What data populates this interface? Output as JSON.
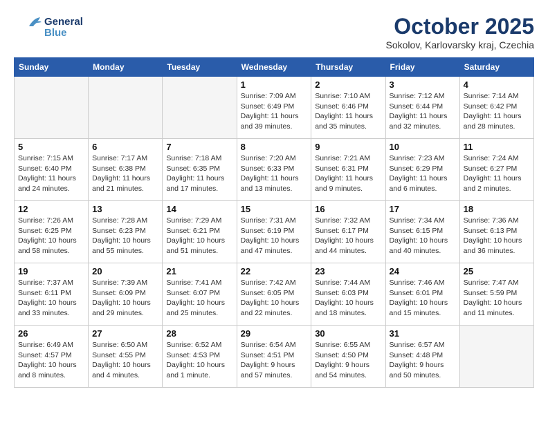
{
  "header": {
    "logo_general": "General",
    "logo_blue": "Blue",
    "month_title": "October 2025",
    "location": "Sokolov, Karlovarsky kraj, Czechia"
  },
  "weekdays": [
    "Sunday",
    "Monday",
    "Tuesday",
    "Wednesday",
    "Thursday",
    "Friday",
    "Saturday"
  ],
  "weeks": [
    [
      {
        "day": "",
        "empty": true
      },
      {
        "day": "",
        "empty": true
      },
      {
        "day": "",
        "empty": true
      },
      {
        "day": "1",
        "sunrise": "7:09 AM",
        "sunset": "6:49 PM",
        "daylight": "11 hours and 39 minutes."
      },
      {
        "day": "2",
        "sunrise": "7:10 AM",
        "sunset": "6:46 PM",
        "daylight": "11 hours and 35 minutes."
      },
      {
        "day": "3",
        "sunrise": "7:12 AM",
        "sunset": "6:44 PM",
        "daylight": "11 hours and 32 minutes."
      },
      {
        "day": "4",
        "sunrise": "7:14 AM",
        "sunset": "6:42 PM",
        "daylight": "11 hours and 28 minutes."
      }
    ],
    [
      {
        "day": "5",
        "sunrise": "7:15 AM",
        "sunset": "6:40 PM",
        "daylight": "11 hours and 24 minutes."
      },
      {
        "day": "6",
        "sunrise": "7:17 AM",
        "sunset": "6:38 PM",
        "daylight": "11 hours and 21 minutes."
      },
      {
        "day": "7",
        "sunrise": "7:18 AM",
        "sunset": "6:35 PM",
        "daylight": "11 hours and 17 minutes."
      },
      {
        "day": "8",
        "sunrise": "7:20 AM",
        "sunset": "6:33 PM",
        "daylight": "11 hours and 13 minutes."
      },
      {
        "day": "9",
        "sunrise": "7:21 AM",
        "sunset": "6:31 PM",
        "daylight": "11 hours and 9 minutes."
      },
      {
        "day": "10",
        "sunrise": "7:23 AM",
        "sunset": "6:29 PM",
        "daylight": "11 hours and 6 minutes."
      },
      {
        "day": "11",
        "sunrise": "7:24 AM",
        "sunset": "6:27 PM",
        "daylight": "11 hours and 2 minutes."
      }
    ],
    [
      {
        "day": "12",
        "sunrise": "7:26 AM",
        "sunset": "6:25 PM",
        "daylight": "10 hours and 58 minutes."
      },
      {
        "day": "13",
        "sunrise": "7:28 AM",
        "sunset": "6:23 PM",
        "daylight": "10 hours and 55 minutes."
      },
      {
        "day": "14",
        "sunrise": "7:29 AM",
        "sunset": "6:21 PM",
        "daylight": "10 hours and 51 minutes."
      },
      {
        "day": "15",
        "sunrise": "7:31 AM",
        "sunset": "6:19 PM",
        "daylight": "10 hours and 47 minutes."
      },
      {
        "day": "16",
        "sunrise": "7:32 AM",
        "sunset": "6:17 PM",
        "daylight": "10 hours and 44 minutes."
      },
      {
        "day": "17",
        "sunrise": "7:34 AM",
        "sunset": "6:15 PM",
        "daylight": "10 hours and 40 minutes."
      },
      {
        "day": "18",
        "sunrise": "7:36 AM",
        "sunset": "6:13 PM",
        "daylight": "10 hours and 36 minutes."
      }
    ],
    [
      {
        "day": "19",
        "sunrise": "7:37 AM",
        "sunset": "6:11 PM",
        "daylight": "10 hours and 33 minutes."
      },
      {
        "day": "20",
        "sunrise": "7:39 AM",
        "sunset": "6:09 PM",
        "daylight": "10 hours and 29 minutes."
      },
      {
        "day": "21",
        "sunrise": "7:41 AM",
        "sunset": "6:07 PM",
        "daylight": "10 hours and 25 minutes."
      },
      {
        "day": "22",
        "sunrise": "7:42 AM",
        "sunset": "6:05 PM",
        "daylight": "10 hours and 22 minutes."
      },
      {
        "day": "23",
        "sunrise": "7:44 AM",
        "sunset": "6:03 PM",
        "daylight": "10 hours and 18 minutes."
      },
      {
        "day": "24",
        "sunrise": "7:46 AM",
        "sunset": "6:01 PM",
        "daylight": "10 hours and 15 minutes."
      },
      {
        "day": "25",
        "sunrise": "7:47 AM",
        "sunset": "5:59 PM",
        "daylight": "10 hours and 11 minutes."
      }
    ],
    [
      {
        "day": "26",
        "sunrise": "6:49 AM",
        "sunset": "4:57 PM",
        "daylight": "10 hours and 8 minutes."
      },
      {
        "day": "27",
        "sunrise": "6:50 AM",
        "sunset": "4:55 PM",
        "daylight": "10 hours and 4 minutes."
      },
      {
        "day": "28",
        "sunrise": "6:52 AM",
        "sunset": "4:53 PM",
        "daylight": "10 hours and 1 minute."
      },
      {
        "day": "29",
        "sunrise": "6:54 AM",
        "sunset": "4:51 PM",
        "daylight": "9 hours and 57 minutes."
      },
      {
        "day": "30",
        "sunrise": "6:55 AM",
        "sunset": "4:50 PM",
        "daylight": "9 hours and 54 minutes."
      },
      {
        "day": "31",
        "sunrise": "6:57 AM",
        "sunset": "4:48 PM",
        "daylight": "9 hours and 50 minutes."
      },
      {
        "day": "",
        "empty": true
      }
    ]
  ],
  "labels": {
    "sunrise_prefix": "Sunrise: ",
    "sunset_prefix": "Sunset: ",
    "daylight_prefix": "Daylight: "
  }
}
